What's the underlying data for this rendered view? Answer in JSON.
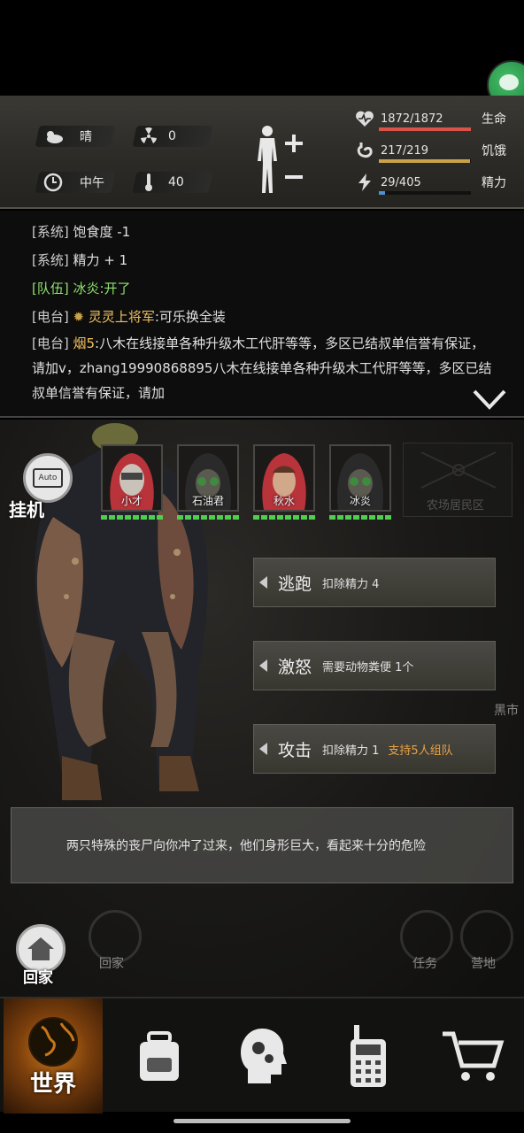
{
  "status": {
    "weather": {
      "icon": "cloudy-sun-icon",
      "label": "晴"
    },
    "radiation": {
      "icon": "radiation-icon",
      "value": "0"
    },
    "time": {
      "icon": "clock-icon",
      "label": "中午"
    },
    "temperature": {
      "icon": "thermometer-icon",
      "value": "40"
    },
    "stats": [
      {
        "key": "life",
        "icon": "heart-monitor-icon",
        "value_text": "1872/1872",
        "name": "生命",
        "fraction": 1.0,
        "color": "#d9534a"
      },
      {
        "key": "hunger",
        "icon": "stomach-icon",
        "value_text": "217/219",
        "name": "饥饿",
        "fraction": 0.99,
        "color": "#c9a24a"
      },
      {
        "key": "energy",
        "icon": "lightning-icon",
        "value_text": "29/405",
        "name": "精力",
        "fraction": 0.072,
        "color": "#4f8fd6"
      }
    ]
  },
  "log": [
    {
      "src": "[系统]",
      "text": " 饱食度 -1"
    },
    {
      "src": "[系统]",
      "text": " 精力 + 1"
    },
    {
      "src": "[队伍]",
      "text": " 冰炎:开了"
    },
    {
      "src": "[电台]",
      "name": "灵灵上将军",
      "text": ":可乐换全装"
    },
    {
      "src": "[电台]",
      "name": "烟5",
      "text": ":八木在线接单各种升级木工代肝等等，多区已结叔单信誉有保证，请加v，zhang19990868895八木在线接单各种升级木工代肝等等，多区已结叔单信誉有保证，请加"
    }
  ],
  "auto": {
    "label": "挂机",
    "screen": "Auto"
  },
  "location_faded": "农场居民区",
  "team": [
    {
      "name": "小才",
      "hood": "#b8333a"
    },
    {
      "name": "石油君",
      "hood": "#2a2a2a"
    },
    {
      "name": "秋水",
      "hood": "#b8333a"
    },
    {
      "name": "冰炎",
      "hood": "#2a2a2a"
    }
  ],
  "actions": [
    {
      "label": "逃跑",
      "desc": "扣除精力 4",
      "extra": ""
    },
    {
      "label": "激怒",
      "desc": "需要动物粪便 1个",
      "extra": ""
    },
    {
      "label": "攻击",
      "desc": "扣除精力 1",
      "extra": "支持5人组队"
    }
  ],
  "description": "两只特殊的丧尸向你冲了过来，他们身形巨大，看起来十分的危险",
  "home": {
    "label": "回家"
  },
  "faded_labels": {
    "home": "回家",
    "task": "任务",
    "camp": "营地",
    "market": "黑市"
  },
  "tabs": [
    {
      "key": "world",
      "label": "世界",
      "icon": "globe-icon",
      "active": true
    },
    {
      "key": "backpack",
      "label": "",
      "icon": "backpack-icon",
      "active": false
    },
    {
      "key": "skills",
      "label": "",
      "icon": "head-gears-icon",
      "active": false
    },
    {
      "key": "radio",
      "label": "",
      "icon": "walkie-talkie-icon",
      "active": false
    },
    {
      "key": "shop",
      "label": "",
      "icon": "shopping-cart-icon",
      "active": false
    }
  ]
}
